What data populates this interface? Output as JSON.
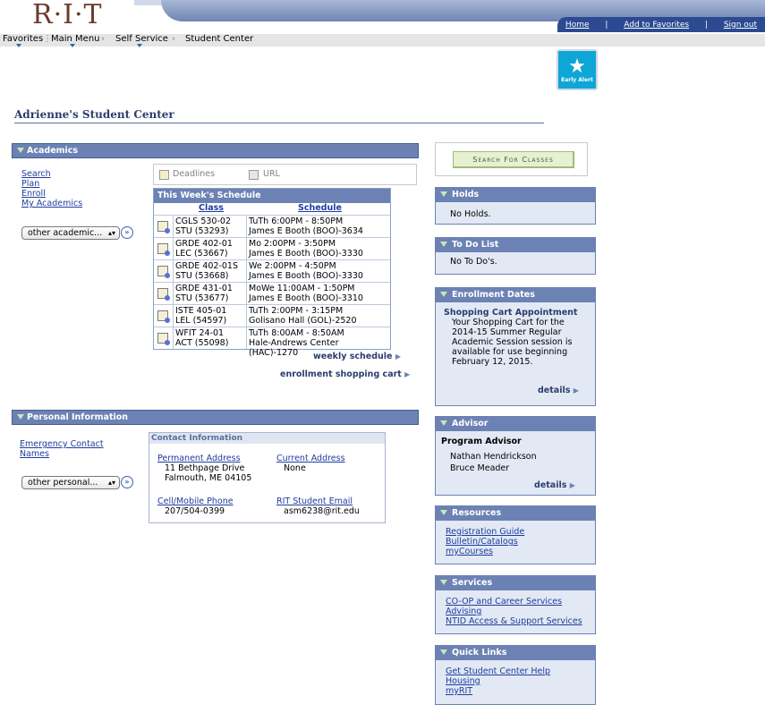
{
  "header": {
    "logo": "R·I·T",
    "links": [
      "Home",
      "Add to Favorites",
      "Sign out"
    ],
    "breadcrumbs": [
      "Favorites",
      "Main Menu",
      "Self Service",
      "Student Center"
    ]
  },
  "early_alert": {
    "label": "Early Alert"
  },
  "page_title": "Adrienne's Student Center",
  "academics": {
    "title": "Academics",
    "links": [
      "Search",
      "Plan",
      "Enroll",
      "My Academics"
    ],
    "dropdown": "other academic...",
    "tabs": [
      "Deadlines",
      "URL"
    ],
    "schedule": {
      "title": "This Week's Schedule",
      "col_class": "Class",
      "col_schedule": "Schedule",
      "rows": [
        {
          "class1": "CGLS 530-02",
          "class2": "STU (53293)",
          "sched1": "TuTh 6:00PM - 8:50PM",
          "sched2": "James E Booth (BOO)-3634"
        },
        {
          "class1": "GRDE 402-01",
          "class2": "LEC (53667)",
          "sched1": "Mo 2:00PM - 3:50PM",
          "sched2": "James E Booth (BOO)-3330"
        },
        {
          "class1": "GRDE 402-01S",
          "class2": "STU (53668)",
          "sched1": "We 2:00PM - 4:50PM",
          "sched2": "James E Booth (BOO)-3330"
        },
        {
          "class1": "GRDE 431-01",
          "class2": "STU (53677)",
          "sched1": "MoWe 11:00AM - 1:50PM",
          "sched2": "James E Booth (BOO)-3310"
        },
        {
          "class1": "ISTE 405-01",
          "class2": "LEL (54597)",
          "sched1": "TuTh 2:00PM - 3:15PM",
          "sched2": "Golisano Hall (GOL)-2520"
        },
        {
          "class1": "WFIT 24-01",
          "class2": "ACT (55098)",
          "sched1": "TuTh 8:00AM - 8:50AM",
          "sched2": "Hale-Andrews Center (HAC)-1270"
        }
      ]
    },
    "weekly_schedule": "weekly schedule",
    "shopping_cart": "enrollment shopping cart"
  },
  "personal": {
    "title": "Personal Information",
    "links": [
      "Emergency Contact",
      "Names"
    ],
    "dropdown": "other personal...",
    "contact": {
      "title": "Contact Information",
      "perm_label": "Permanent Address",
      "perm_line1": "11 Bethpage Drive",
      "perm_line2": "Falmouth, ME 04105",
      "curr_label": "Current Address",
      "curr_value": "None",
      "phone_label": "Cell/Mobile Phone",
      "phone_value": "207/504-0399",
      "email_label": "RIT Student Email",
      "email_value": "asm6238@rit.edu"
    }
  },
  "right": {
    "search_button": "Search For Classes",
    "holds": {
      "title": "Holds",
      "text": "No Holds."
    },
    "todo": {
      "title": "To Do List",
      "text": "No To Do's."
    },
    "enrollment": {
      "title": "Enrollment Dates",
      "subtitle": "Shopping Cart Appointment",
      "lines": [
        "Your Shopping Cart for the",
        "2014-15 Summer Regular",
        "Academic Session session is",
        "available for use beginning",
        "February 12, 2015."
      ],
      "details": "details"
    },
    "advisor": {
      "title": "Advisor",
      "subtitle": "Program Advisor",
      "names": [
        "Nathan Hendrickson",
        "Bruce Meader"
      ],
      "details": "details"
    },
    "resources": {
      "title": "Resources",
      "links": [
        "Registration Guide",
        "Bulletin/Catalogs",
        "myCourses"
      ]
    },
    "services": {
      "title": "Services",
      "links": [
        "CO-OP and Career Services",
        "Advising",
        "NTID Access & Support Services"
      ]
    },
    "quicklinks": {
      "title": "Quick Links",
      "links": [
        "Get Student Center Help",
        "Housing",
        "myRIT"
      ]
    }
  }
}
